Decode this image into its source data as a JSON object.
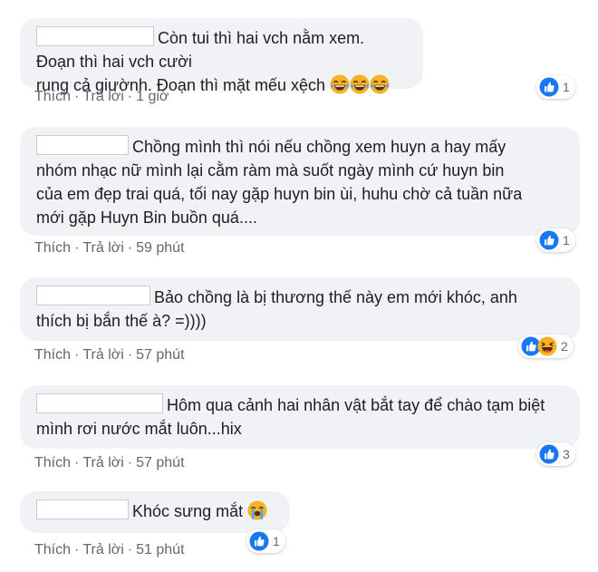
{
  "colors": {
    "bubble": "#f0f2f5",
    "meta_text": "#65676b",
    "like_blue": "#1877f2",
    "emoji_yellow": "#f7b125"
  },
  "comments": [
    {
      "text_lines": [
        "Còn tui thì hai vch nằm xem. Đoạn thì hai vch cười",
        "rung cả giườnh. Đoạn thì mặt mếu xệch"
      ],
      "emojis": [
        "laughing-tears-icon",
        "laughing-tears-icon",
        "laughing-tears-icon"
      ],
      "like_label": "Thích",
      "reply_label": "Trả lời",
      "time": "1 giờ",
      "reactions": [
        "like-icon"
      ],
      "reaction_count": "1"
    },
    {
      "text_lines": [
        "Chồng mình thì nói nếu chồng xem huyn a hay mấy",
        "nhóm nhạc nữ mình lại cằm ràm mà suốt ngày mình cứ huyn bin",
        "của em đẹp trai quá, tối nay gặp huyn bin ùi, huhu chờ cả tuần nữa",
        "mới gặp Huyn Bin buồn quá...."
      ],
      "like_label": "Thích",
      "reply_label": "Trả lời",
      "time": "59 phút",
      "reactions": [
        "like-icon"
      ],
      "reaction_count": "1"
    },
    {
      "text_lines": [
        "Bảo chồng là bị thương thế này em mới khóc, anh",
        "thích bị bắn thế à? =))))"
      ],
      "like_label": "Thích",
      "reply_label": "Trả lời",
      "time": "57 phút",
      "reactions": [
        "like-icon",
        "haha-icon"
      ],
      "reaction_count": "2"
    },
    {
      "text_lines": [
        "Hôm qua cảnh hai nhân vật bắt tay để chào tạm biệt",
        "mình rơi nước mắt luôn...hix"
      ],
      "like_label": "Thích",
      "reply_label": "Trả lời",
      "time": "57 phút",
      "reactions": [
        "like-icon"
      ],
      "reaction_count": "3"
    },
    {
      "text_lines": [
        "Khóc sưng mắt"
      ],
      "emojis": [
        "loudly-crying-icon"
      ],
      "like_label": "Thích",
      "reply_label": "Trả lời",
      "time": "51 phút",
      "reactions": [
        "like-icon"
      ],
      "reaction_count": "1"
    }
  ]
}
